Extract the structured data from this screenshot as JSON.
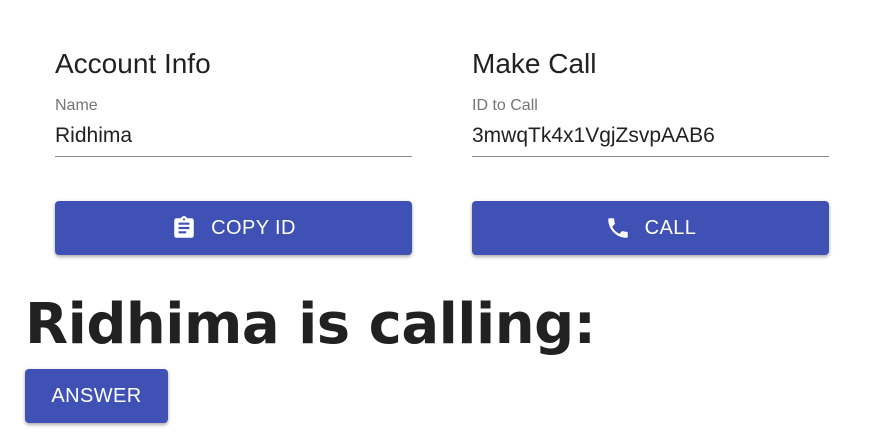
{
  "account": {
    "title": "Account Info",
    "name_label": "Name",
    "name_value": "Ridhima",
    "copy_button_label": "COPY ID",
    "copy_icon": "clipboard-icon"
  },
  "call": {
    "title": "Make Call",
    "id_label": "ID to Call",
    "id_value": "3mwqTk4x1VgjZsvpAAB6",
    "call_button_label": "CALL",
    "call_icon": "phone-icon"
  },
  "incoming": {
    "heading": "Ridhima is calling:",
    "answer_label": "ANSWER"
  },
  "colors": {
    "primary": "#3f51b5",
    "text": "#212121",
    "label": "#757575"
  }
}
